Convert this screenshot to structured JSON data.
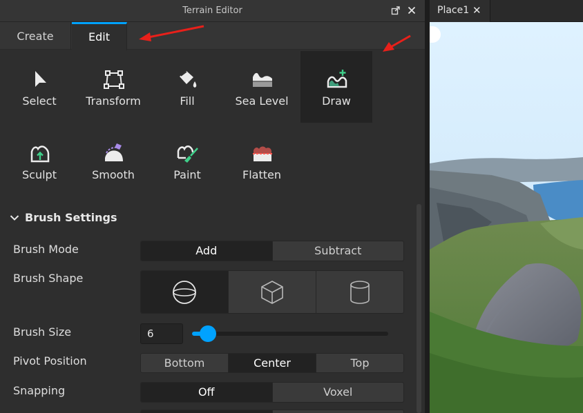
{
  "window": {
    "title": "Terrain Editor"
  },
  "tabs": [
    {
      "label": "Create",
      "active": false
    },
    {
      "label": "Edit",
      "active": true
    }
  ],
  "tools": [
    {
      "label": "Select",
      "icon": "cursor-arrow-icon",
      "active": false
    },
    {
      "label": "Transform",
      "icon": "transform-box-icon",
      "active": false
    },
    {
      "label": "Fill",
      "icon": "paint-bucket-icon",
      "active": false
    },
    {
      "label": "Sea Level",
      "icon": "sea-level-icon",
      "active": false
    },
    {
      "label": "Draw",
      "icon": "draw-terrain-icon",
      "active": true
    },
    {
      "label": "Sculpt",
      "icon": "sculpt-icon",
      "active": false
    },
    {
      "label": "Smooth",
      "icon": "smooth-icon",
      "active": false
    },
    {
      "label": "Paint",
      "icon": "paint-brush-icon",
      "active": false
    },
    {
      "label": "Flatten",
      "icon": "flatten-icon",
      "active": false
    }
  ],
  "brush_settings": {
    "heading": "Brush Settings",
    "brush_mode": {
      "label": "Brush Mode",
      "options": [
        "Add",
        "Subtract"
      ],
      "selected": "Add"
    },
    "brush_shape": {
      "label": "Brush Shape",
      "options": [
        "sphere-icon",
        "cube-icon",
        "cylinder-icon"
      ],
      "selected": "sphere-icon"
    },
    "brush_size": {
      "label": "Brush Size",
      "value": "6",
      "slider_fraction": 0.08
    },
    "pivot_position": {
      "label": "Pivot Position",
      "options": [
        "Bottom",
        "Center",
        "Top"
      ],
      "selected": "Center"
    },
    "snapping": {
      "label": "Snapping",
      "options": [
        "Off",
        "Voxel"
      ],
      "selected": "Off"
    }
  },
  "document_tab": {
    "label": "Place1"
  },
  "colors": {
    "accent": "#00a2ff",
    "annotation_arrow": "#e8201a",
    "draw_icon_plus": "#3fd08a"
  }
}
